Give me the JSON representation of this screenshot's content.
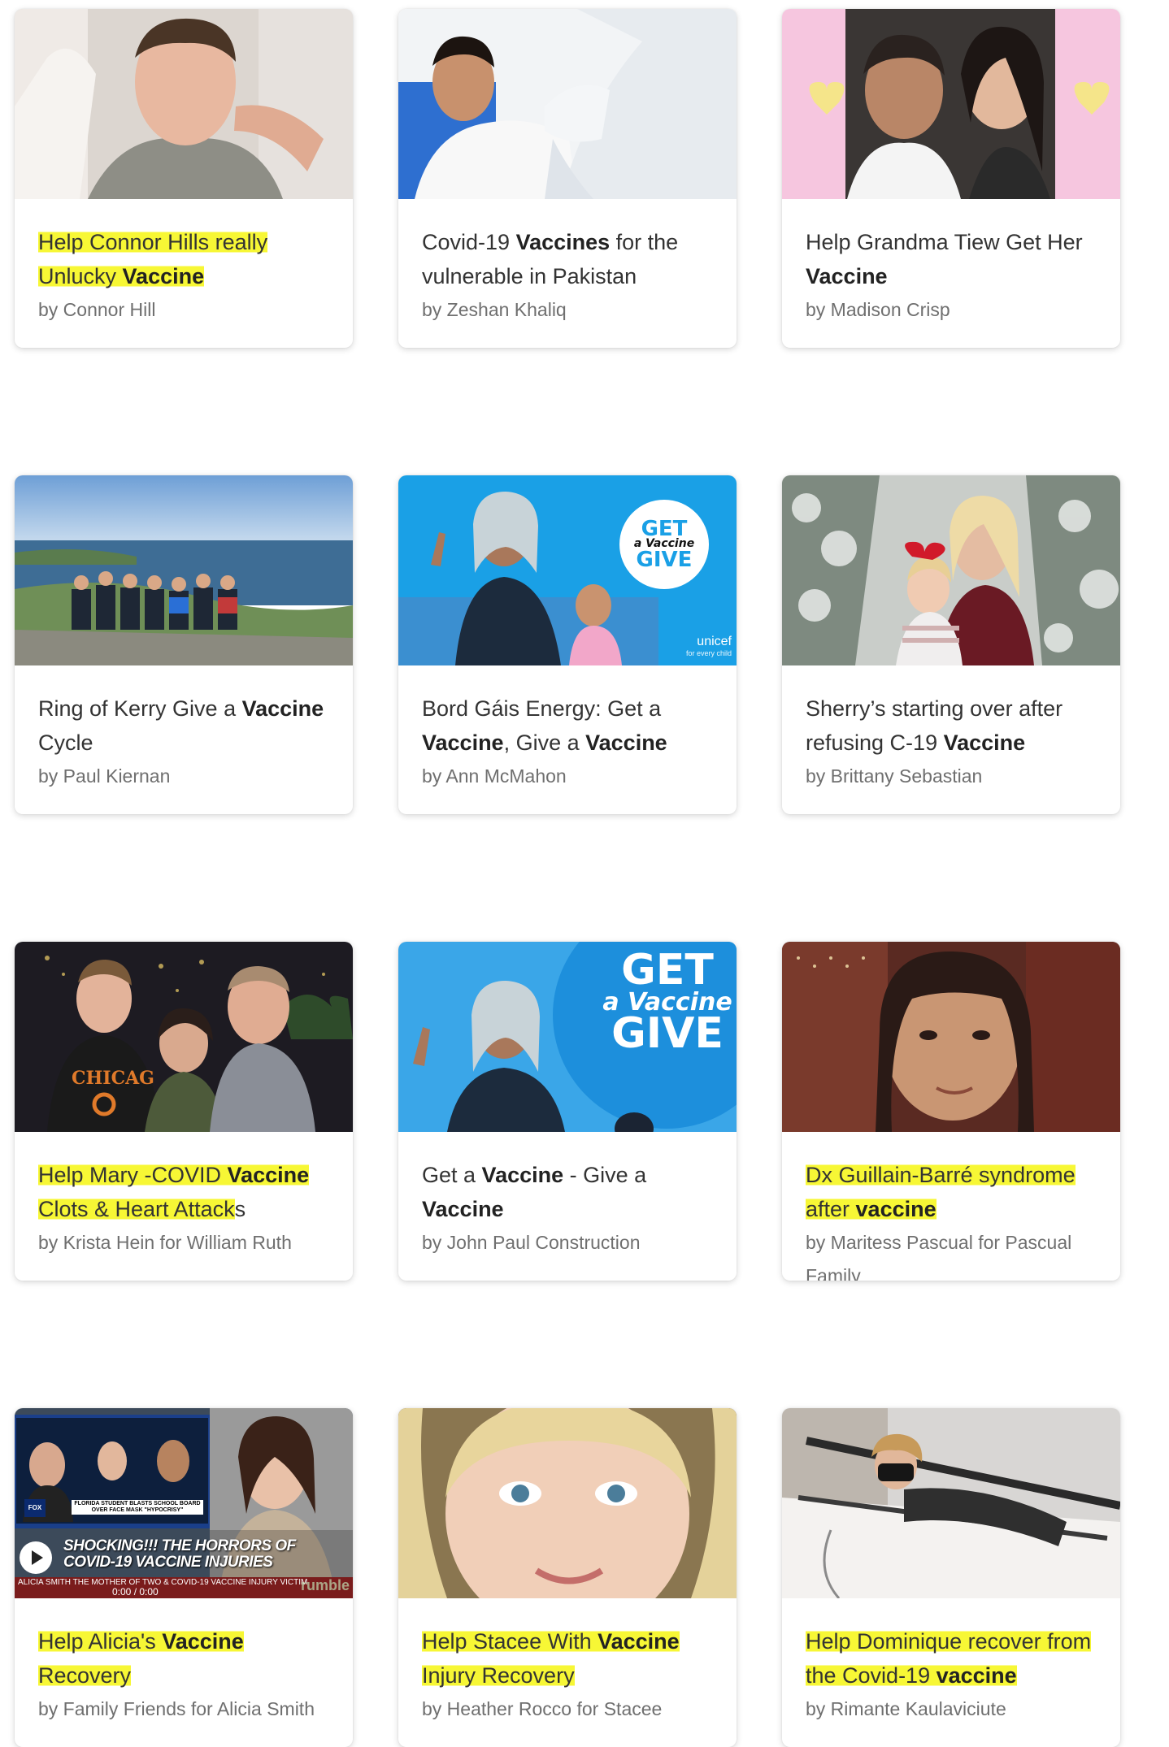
{
  "campaigns": [
    {
      "title_parts": [
        {
          "t": "Help Connor Hills really Unlucky ",
          "b": false,
          "hl": true
        },
        {
          "t": "Vaccine",
          "b": true,
          "hl": true
        }
      ],
      "byline": "by Connor Hill",
      "image": "hospital-selfie"
    },
    {
      "title_parts": [
        {
          "t": "Covid-19 ",
          "b": false
        },
        {
          "t": "Vaccines",
          "b": true
        },
        {
          "t": " for the vulnerable in Pakistan",
          "b": false
        }
      ],
      "byline": "by Zeshan Khaliq",
      "image": "nasal-swab"
    },
    {
      "title_parts": [
        {
          "t": "Help Grandma Tiew Get Her ",
          "b": false
        },
        {
          "t": "Vaccine",
          "b": true
        }
      ],
      "byline": "by Madison Crisp",
      "image": "grandma-hearts"
    },
    {
      "title_parts": [
        {
          "t": "Ring of Kerry Give a ",
          "b": false
        },
        {
          "t": "Vaccine",
          "b": true
        },
        {
          "t": " Cycle",
          "b": false
        }
      ],
      "byline": "by Paul Kiernan",
      "image": "cyclists-coast"
    },
    {
      "title_parts": [
        {
          "t": "Bord Gáis Energy: Get a ",
          "b": false
        },
        {
          "t": "Vaccine",
          "b": true
        },
        {
          "t": ", Give a ",
          "b": false
        },
        {
          "t": "Vaccine",
          "b": true
        }
      ],
      "byline": "by Ann McMahon",
      "image": "unicef-get-give",
      "badge": {
        "top": "GET",
        "mid": "a Vaccine",
        "bottom": "GIVE"
      },
      "brand": "unicef",
      "brand_sub": "for every child"
    },
    {
      "title_parts": [
        {
          "t": "Sherry’s starting over after refusing C-19 ",
          "b": false
        },
        {
          "t": "Vaccine",
          "b": true
        }
      ],
      "byline": "by Brittany Sebastian",
      "image": "snow-trees"
    },
    {
      "title_parts": [
        {
          "t": "Help Mary -COVID ",
          "b": false,
          "hl": true
        },
        {
          "t": "Vaccine",
          "b": true,
          "hl": true
        },
        {
          "t": " Clots & Heart Attack",
          "b": false,
          "hl": true
        },
        {
          "t": "s",
          "b": false
        }
      ],
      "byline": "by Krista Hein for William Ruth",
      "image": "chicago-night"
    },
    {
      "title_parts": [
        {
          "t": "Get a ",
          "b": false
        },
        {
          "t": "Vaccine",
          "b": true
        },
        {
          "t": " - Give a ",
          "b": false
        },
        {
          "t": "Vaccine",
          "b": true
        }
      ],
      "byline": "by John Paul Construction",
      "image": "get-give-large",
      "badge": {
        "top": "GET",
        "mid": "a Vaccine",
        "bottom": "GIVE"
      }
    },
    {
      "title_parts": [
        {
          "t": "Dx Guillain-Barré syndrome after ",
          "b": false,
          "hl": true
        },
        {
          "t": "vaccine",
          "b": true,
          "hl": true
        }
      ],
      "byline": "by Maritess Pascual for Pascual Family",
      "image": "woman-portrait"
    },
    {
      "title_parts": [
        {
          "t": "Help Alicia's ",
          "b": false,
          "hl": true
        },
        {
          "t": "Vaccine",
          "b": true,
          "hl": true
        },
        {
          "t": " Recovery",
          "b": false,
          "hl": true
        }
      ],
      "byline": "by Family Friends for Alicia Smith",
      "image": "news-video",
      "video": {
        "headline": "SHOCKING!!! THE HORRORS OF COVID-19 VACCINE INJURIES",
        "caption": "FLORIDA STUDENT BLASTS SCHOOL BOARD OVER FACE MASK \"HYPOCRISY\"",
        "ticker": "ALICIA SMITH THE MOTHER OF TWO & COVID-19 VACCINE INJURY VICTIM",
        "time": "0:00 / 0:00",
        "channel": "FOX",
        "watermark": "rumble"
      }
    },
    {
      "title_parts": [
        {
          "t": "Help Stacee With ",
          "b": false,
          "hl": true
        },
        {
          "t": "Vaccine",
          "b": true,
          "hl": true
        },
        {
          "t": " Injury Recovery",
          "b": false,
          "hl": true
        }
      ],
      "byline": "by Heather Rocco for Stacee",
      "image": "blonde-closeup"
    },
    {
      "title_parts": [
        {
          "t": "Help Dominique recover from the Covid-19 ",
          "b": false,
          "hl": true
        },
        {
          "t": "vaccine",
          "b": true,
          "hl": true
        }
      ],
      "byline": "by Rimante Kaulaviciute",
      "image": "hospital-bed"
    }
  ],
  "colors": {
    "highlight": "#f7f735",
    "title": "#333333",
    "byline": "#6f6f6f",
    "unicef_blue": "#1aa0e6"
  }
}
